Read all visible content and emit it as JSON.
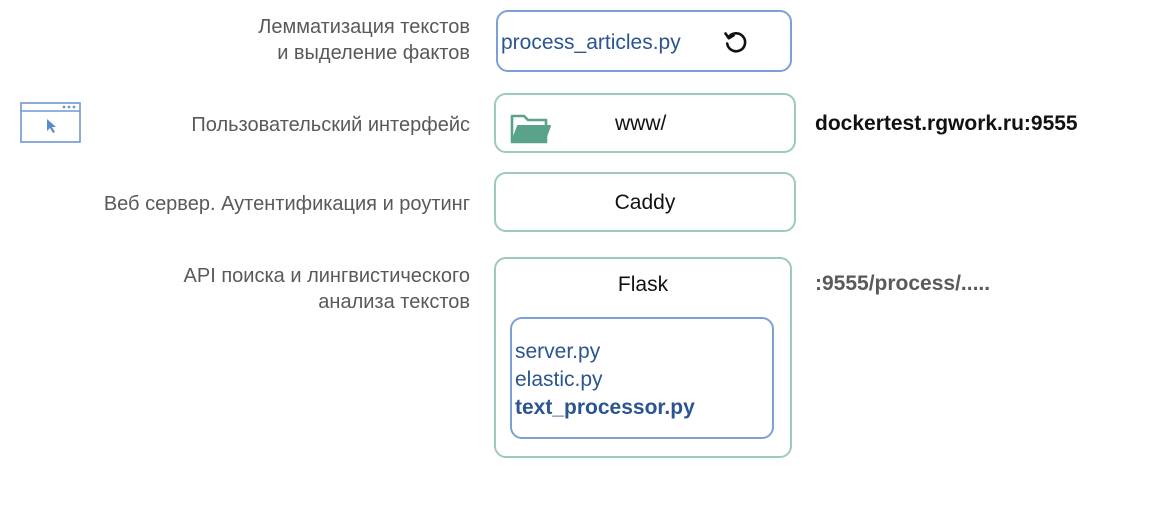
{
  "rows": {
    "lemmatization": {
      "label_line1": "Лемматизация текстов",
      "label_line2": "и выделение фактов",
      "file": "process_articles.py",
      "icon": "refresh-icon"
    },
    "ui": {
      "label": "Пользовательский интерфейс",
      "folder": "www/",
      "host": "dockertest.rgwork.ru:9555",
      "icon": "browser-window-icon",
      "folder_icon": "folder-icon"
    },
    "webserver": {
      "label": "Веб сервер. Аутентификация и роутинг",
      "name": "Caddy"
    },
    "api": {
      "label_line1": "API поиска и лингвистического",
      "label_line2": "анализа текстов",
      "name": "Flask",
      "route": ":9555/process/.....",
      "files": [
        "server.py",
        "elastic.py",
        "text_processor.py"
      ]
    }
  },
  "colors": {
    "blue_border": "#7da0d3",
    "green_border": "#9ccbb9",
    "code_text": "#2b5590",
    "label_text": "#595959"
  }
}
